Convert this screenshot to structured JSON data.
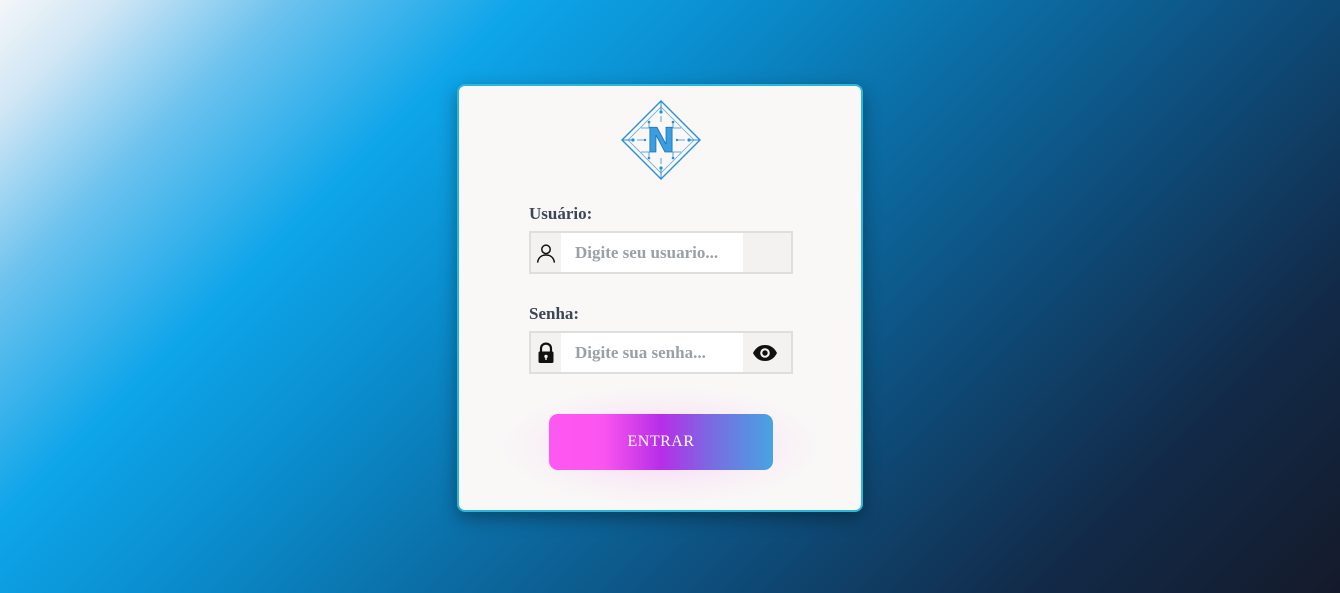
{
  "login": {
    "logo_letter": "N",
    "username_label": "Usuário:",
    "username_placeholder": "Digite seu usuario...",
    "username_value": "",
    "password_label": "Senha:",
    "password_placeholder": "Digite sua senha...",
    "password_value": "",
    "submit_label": "ENTRAR"
  },
  "icons": {
    "logo": "diamond-circuit-logo",
    "user": "user-icon",
    "lock": "lock-icon",
    "show_password": "eye-icon"
  },
  "colors": {
    "card_border": "#29b8d8",
    "button_start": "#ff58f2",
    "button_mid": "#b72ee8",
    "button_end": "#47a4e2",
    "label_text": "#3d4656",
    "logo_blue": "#2a8fd8"
  }
}
